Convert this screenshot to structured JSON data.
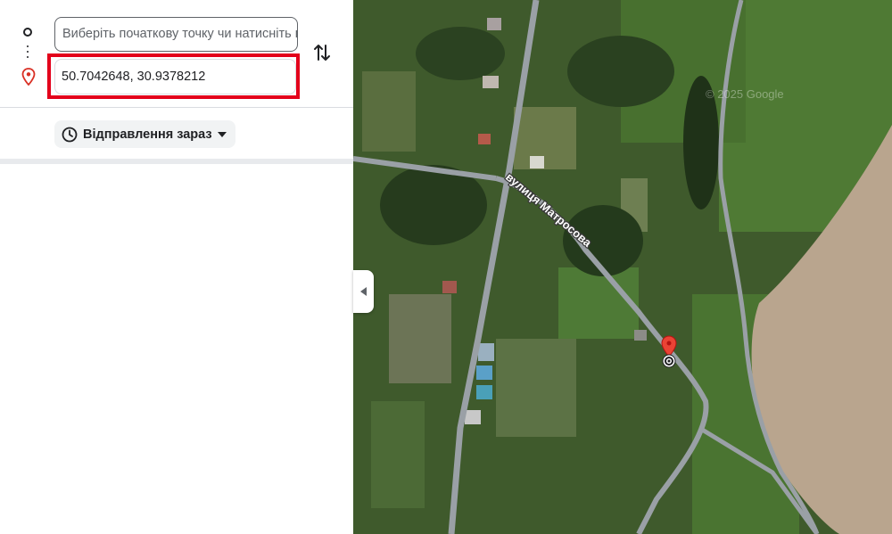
{
  "directions": {
    "origin_placeholder": "Виберіть початкову точку чи натисніть на карті",
    "destination_value": "50.7042648, 30.9378212",
    "depart_label": "Відправлення зараз"
  },
  "map": {
    "street_label": "вулиця Матросова",
    "watermark": "© 2025 Google"
  },
  "icons": {
    "origin": "origin-circle-icon",
    "destination": "map-pin-icon",
    "swap": "swap-arrows-icon",
    "depart": "clock-icon",
    "dropdown": "caret-down-icon",
    "collapse": "chevron-left-icon"
  },
  "colors": {
    "highlight": "#e3001b",
    "pin": "#ea4335",
    "road": "#9aa0a6"
  }
}
